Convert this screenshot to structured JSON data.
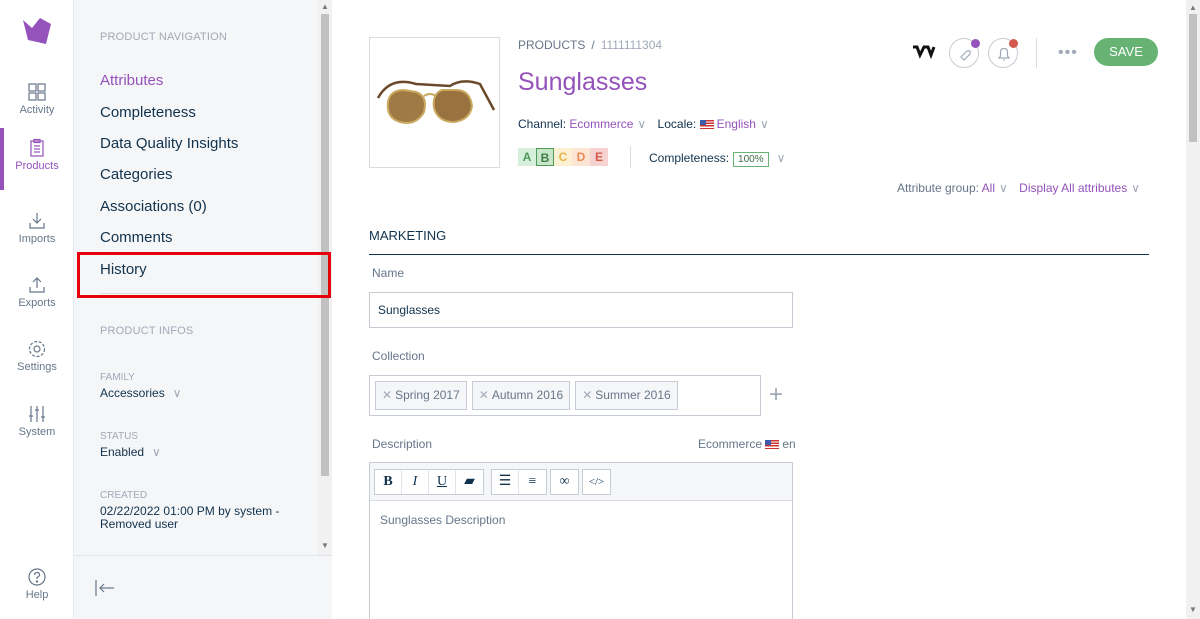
{
  "mainnav": {
    "items": [
      {
        "label": "Activity",
        "icon": "grid-icon"
      },
      {
        "label": "Products",
        "icon": "clipboard-icon",
        "active": true
      },
      {
        "label": "Imports",
        "icon": "download-icon"
      },
      {
        "label": "Exports",
        "icon": "upload-icon"
      },
      {
        "label": "Settings",
        "icon": "gear-icon"
      },
      {
        "label": "System",
        "icon": "sliders-icon"
      }
    ],
    "help": "Help"
  },
  "column": {
    "nav_title": "PRODUCT NAVIGATION",
    "links": [
      "Attributes",
      "Completeness",
      "Data Quality Insights",
      "Categories",
      "Associations (0)",
      "Comments",
      "History"
    ],
    "infos_title": "PRODUCT INFOS",
    "family_label": "FAMILY",
    "family_value": "Accessories",
    "status_label": "STATUS",
    "status_value": "Enabled",
    "created_label": "CREATED",
    "created_value": "02/22/2022 01:00 PM by system - Removed user"
  },
  "header": {
    "breadcrumb_root": "PRODUCTS",
    "breadcrumb_code": "1111111304",
    "title": "Sunglasses",
    "channel_label": "Channel:",
    "channel_value": "Ecommerce",
    "locale_label": "Locale:",
    "locale_value": "English",
    "dqi_grades": [
      "A",
      "B",
      "C",
      "D",
      "E"
    ],
    "completeness_label": "Completeness:",
    "completeness_value": "100%",
    "save_label": "SAVE",
    "more_label": "•••"
  },
  "filters": {
    "group_label": "Attribute group:",
    "group_value": "All",
    "display_value": "Display All attributes"
  },
  "form": {
    "group_title": "MARKETING",
    "name_label": "Name",
    "name_value": "Sunglasses",
    "collection_label": "Collection",
    "collection_tags": [
      "Spring 2017",
      "Autumn 2016",
      "Summer 2016"
    ],
    "description_label": "Description",
    "description_scope": "Ecommerce",
    "description_locale": "en",
    "description_value": "Sunglasses Description"
  },
  "colors": {
    "brand": "#9452ba",
    "save": "#67b373",
    "highlight": "#e5000b"
  }
}
